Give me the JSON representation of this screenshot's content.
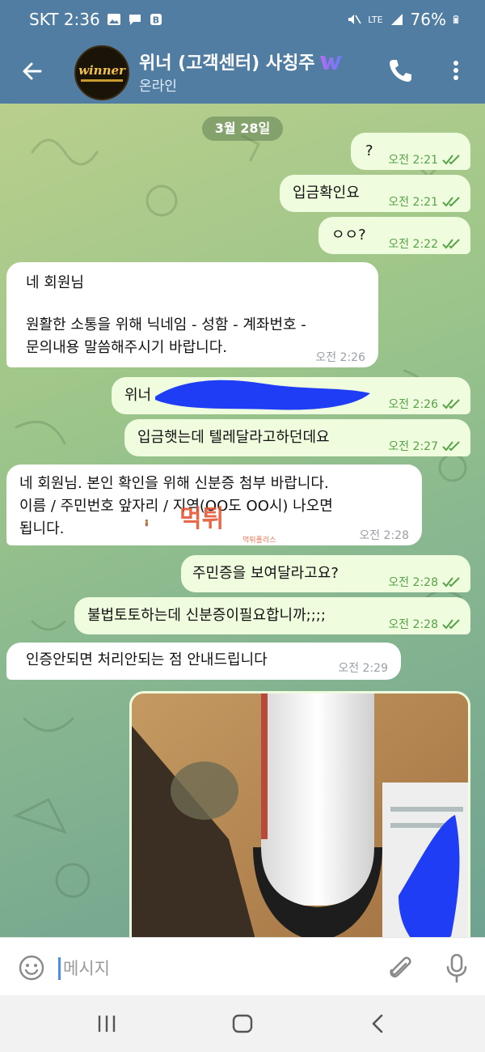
{
  "status_bar": {
    "carrier_time": "SKT 2:36",
    "battery": "76%",
    "network": "LTE"
  },
  "header": {
    "title": "위너 (고객센터) 사칭주",
    "subtitle": "온라인",
    "avatar_logo": "winner"
  },
  "chat": {
    "date": "3월 28일",
    "messages": [
      {
        "dir": "out",
        "text": "?",
        "time": "오전 2:21"
      },
      {
        "dir": "out",
        "text": "입금확인요",
        "time": "오전 2:21"
      },
      {
        "dir": "out",
        "text": "ㅇㅇ?",
        "time": "오전 2:22"
      },
      {
        "dir": "in",
        "lines": [
          "네 회원님",
          "",
          "원활한 소통을 위해 닉네임 - 성함 - 계좌번호 -",
          "문의내용 말씀해주시기 바랍니다."
        ],
        "time": "오전 2:26"
      },
      {
        "dir": "out",
        "text": "위너",
        "time": "오전 2:26"
      },
      {
        "dir": "out",
        "text": "입금햇는데 텔레달라고하던데요",
        "time": "오전 2:27"
      },
      {
        "dir": "in",
        "lines": [
          "네 회원님. 본인 확인을 위해 신분증 첨부 바랍니다.",
          "이름 / 주민번호 앞자리 / 지역(OO도 OO시) 나오면",
          "됩니다."
        ],
        "time": "오전 2:28"
      },
      {
        "dir": "out",
        "text": "주민증을 보여달라고요?",
        "time": "오전 2:28"
      },
      {
        "dir": "out",
        "text": "불법토토하는데 신분증이필요합니까;;;;",
        "time": "오전 2:28"
      },
      {
        "dir": "in",
        "text": "인증안되면 처리안되는 점 안내드립니다",
        "time": "오전 2:29"
      }
    ],
    "watermark": "먹튀",
    "watermark_sub": "먹튀폴리스"
  },
  "input": {
    "placeholder": "메시지"
  },
  "colors": {
    "header": "#527da3",
    "outgoing": "#effdde",
    "incoming": "#ffffff",
    "time_out": "#57a249"
  }
}
